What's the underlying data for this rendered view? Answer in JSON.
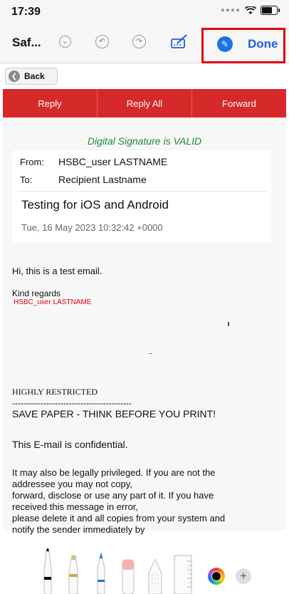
{
  "status_bar": {
    "time": "17:39"
  },
  "toolbar": {
    "app_title": "Saf...",
    "done_label": "Done"
  },
  "nav": {
    "back_label": "Back"
  },
  "actions": [
    {
      "label": "Reply"
    },
    {
      "label": "Reply All"
    },
    {
      "label": "Forward"
    }
  ],
  "email": {
    "signature_status": "Digital Signature is VALID",
    "from_label": "From:",
    "from": "HSBC_user LASTNAME",
    "to_label": "To:",
    "to": "Recipient Lastname",
    "subject": "Testing for iOS and Android",
    "date": "Tue, 16 May 2023 10:32:42 +0000",
    "greeting": "Hi, this is a test email.",
    "closing": "Kind regards",
    "sender_name": "HSBC_user LASTNAME",
    "classification": "HIGHLY RESTRICTED",
    "separator": "------------------------------------------",
    "save_paper": "SAVE PAPER - THINK BEFORE YOU PRINT!",
    "confidential": "This E-mail is confidential.",
    "disclaimer": "It may also be legally privileged. If you are not the\naddressee you may not copy,\nforward, disclose or use any part of it. If you have\nreceived this message in error,\nplease delete it and all copies from your system and\nnotify the sender immediately by"
  },
  "tools": [
    "pen-tool",
    "marker-tool",
    "pencil-tool",
    "eraser-tool",
    "lasso-tool",
    "ruler-tool"
  ],
  "colors": {
    "accent_red": "#d62a2a",
    "done_blue": "#1a5fe8",
    "valid_green": "#1f8b3c",
    "highlight_red": "#e00010"
  }
}
